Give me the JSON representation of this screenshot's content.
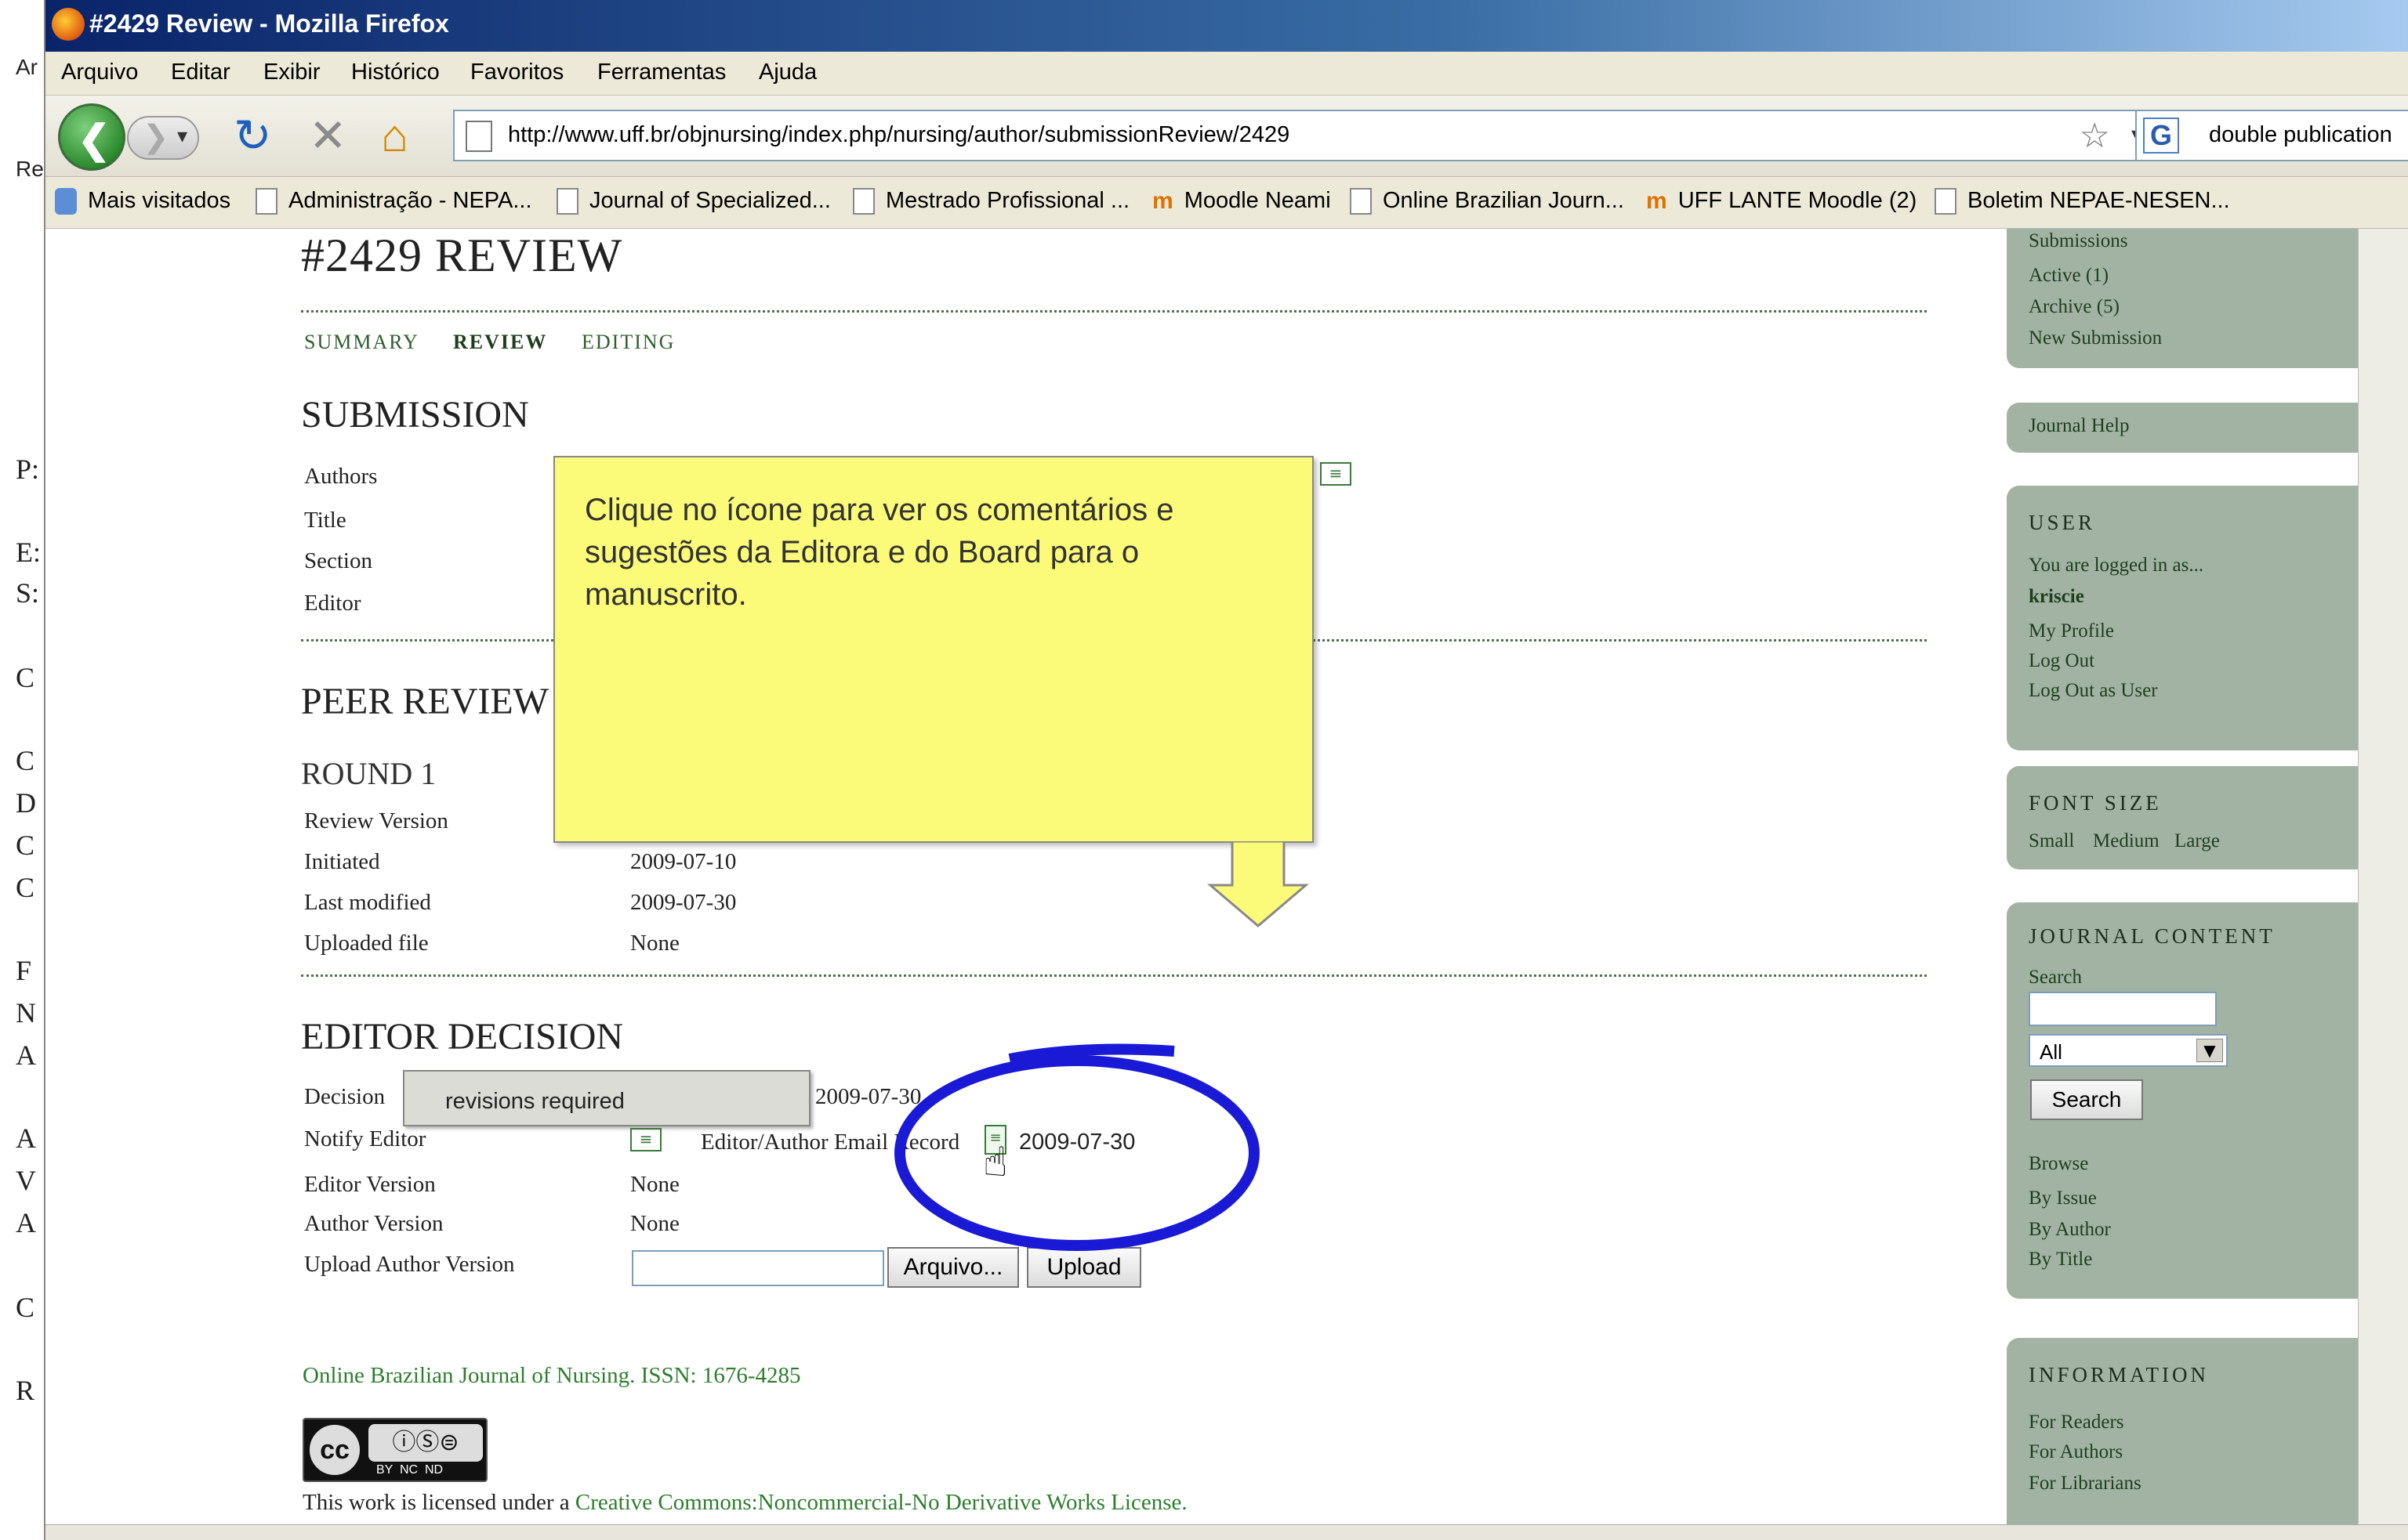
{
  "window": {
    "title": "#2429 Review - Mozilla Firefox"
  },
  "menu": [
    "Arquivo",
    "Editar",
    "Exibir",
    "Histórico",
    "Favoritos",
    "Ferramentas",
    "Ajuda"
  ],
  "nav": {
    "url": "http://www.uff.br/objnursing/index.php/nursing/author/submissionReview/2429",
    "search_value": "double publication"
  },
  "bookmarks": [
    "Mais visitados",
    "Administração - NEPA...",
    "Journal of Specialized...",
    "Mestrado Profissional ...",
    "Moodle Neami",
    "Online Brazilian Journ...",
    "UFF LANTE Moodle (2)",
    "Boletim NEPAE-NESEN..."
  ],
  "behind_window": {
    "letters": [
      "Ar",
      "Re",
      "P:",
      "E:",
      "S:",
      "C",
      "C",
      "D",
      "C",
      "C",
      "F",
      "N",
      "A",
      "A",
      "V",
      "A",
      "C",
      "R"
    ]
  },
  "page": {
    "title": "#2429 REVIEW",
    "tabs": [
      "SUMMARY",
      "REVIEW",
      "EDITING"
    ],
    "submission": {
      "heading": "SUBMISSION",
      "labels": [
        "Authors",
        "Title",
        "Section",
        "Editor"
      ]
    },
    "peer_review": {
      "heading": "PEER REVIEW",
      "round": "ROUND 1",
      "rows": [
        {
          "label": "Review Version",
          "value": ""
        },
        {
          "label": "Initiated",
          "value": "2009-07-10"
        },
        {
          "label": "Last modified",
          "value": "2009-07-30"
        },
        {
          "label": "Uploaded file",
          "value": "None"
        }
      ]
    },
    "editor_decision": {
      "heading": "EDITOR DECISION",
      "decision_label": "Decision",
      "decision_value": "revisions required",
      "decision_date": "2009-07-30",
      "notify_label": "Notify Editor",
      "email_record_label": "Editor/Author Email Record",
      "email_record_date": "2009-07-30",
      "editor_version_label": "Editor Version",
      "editor_version_value": "None",
      "author_version_label": "Author Version",
      "author_version_value": "None",
      "upload_label": "Upload Author Version",
      "browse_button": "Arquivo...",
      "upload_button": "Upload"
    },
    "footer": {
      "journal": "Online Brazilian Journal of Nursing. ISSN: 1676-4285",
      "license_prefix": "This work is licensed under a ",
      "license_link": "Creative Commons:Noncommercial-No Derivative Works License.",
      "cc_badge": "BY  NC  ND"
    }
  },
  "sidebar": {
    "submissions": {
      "heading": "Submissions",
      "links": [
        "Active (1)",
        "Archive (5)",
        "New Submission"
      ]
    },
    "journal_help": "Journal Help",
    "user": {
      "heading": "USER",
      "logged_in": "You are logged in as...",
      "username": "kriscie",
      "links": [
        "My Profile",
        "Log Out",
        "Log Out as User"
      ]
    },
    "font_size": {
      "heading": "FONT SIZE",
      "options": [
        "Small",
        "Medium",
        "Large"
      ]
    },
    "journal_content": {
      "heading": "JOURNAL CONTENT",
      "search_label": "Search",
      "scope_value": "All",
      "search_button": "Search",
      "browse_label": "Browse",
      "browse_links": [
        "By Issue",
        "By Author",
        "By Title"
      ]
    },
    "information": {
      "heading": "INFORMATION",
      "links": [
        "For Readers",
        "For Authors",
        "For Librarians"
      ]
    }
  },
  "callout": {
    "text": "Clique no ícone para ver os comentários e sugestões da Editora e do Board para o manuscrito."
  },
  "colors": {
    "sidebar_bg": "#a3b3a3",
    "callout_bg": "#fcfb79",
    "annotation_circle": "#1a1ad6",
    "link_green": "#2e7d2e"
  }
}
